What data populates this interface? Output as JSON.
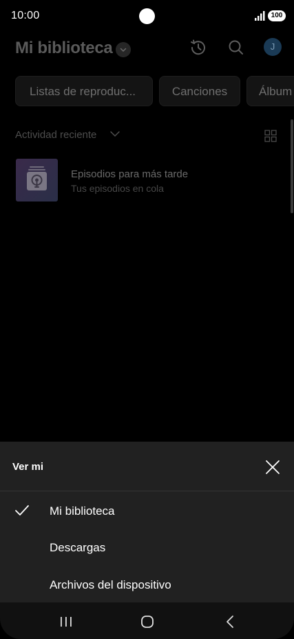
{
  "status_bar": {
    "time": "10:00",
    "battery": "100"
  },
  "header": {
    "title": "Mi biblioteca",
    "avatar_initial": "J",
    "icons": [
      "history-icon",
      "search-icon"
    ]
  },
  "chips": [
    "Listas de reproduc...",
    "Canciones",
    "Álbum"
  ],
  "sort": {
    "label": "Actividad reciente"
  },
  "library_items": [
    {
      "title": "Episodios para más tarde",
      "subtitle": "Tus episodios en cola"
    }
  ],
  "sheet": {
    "title": "Ver mi",
    "options": [
      {
        "label": "Mi biblioteca",
        "selected": true
      },
      {
        "label": "Descargas",
        "selected": false
      },
      {
        "label": "Archivos del dispositivo",
        "selected": false
      }
    ]
  },
  "colors": {
    "background": "#000000",
    "sheet": "#212121",
    "avatar": "#1a3a55"
  }
}
